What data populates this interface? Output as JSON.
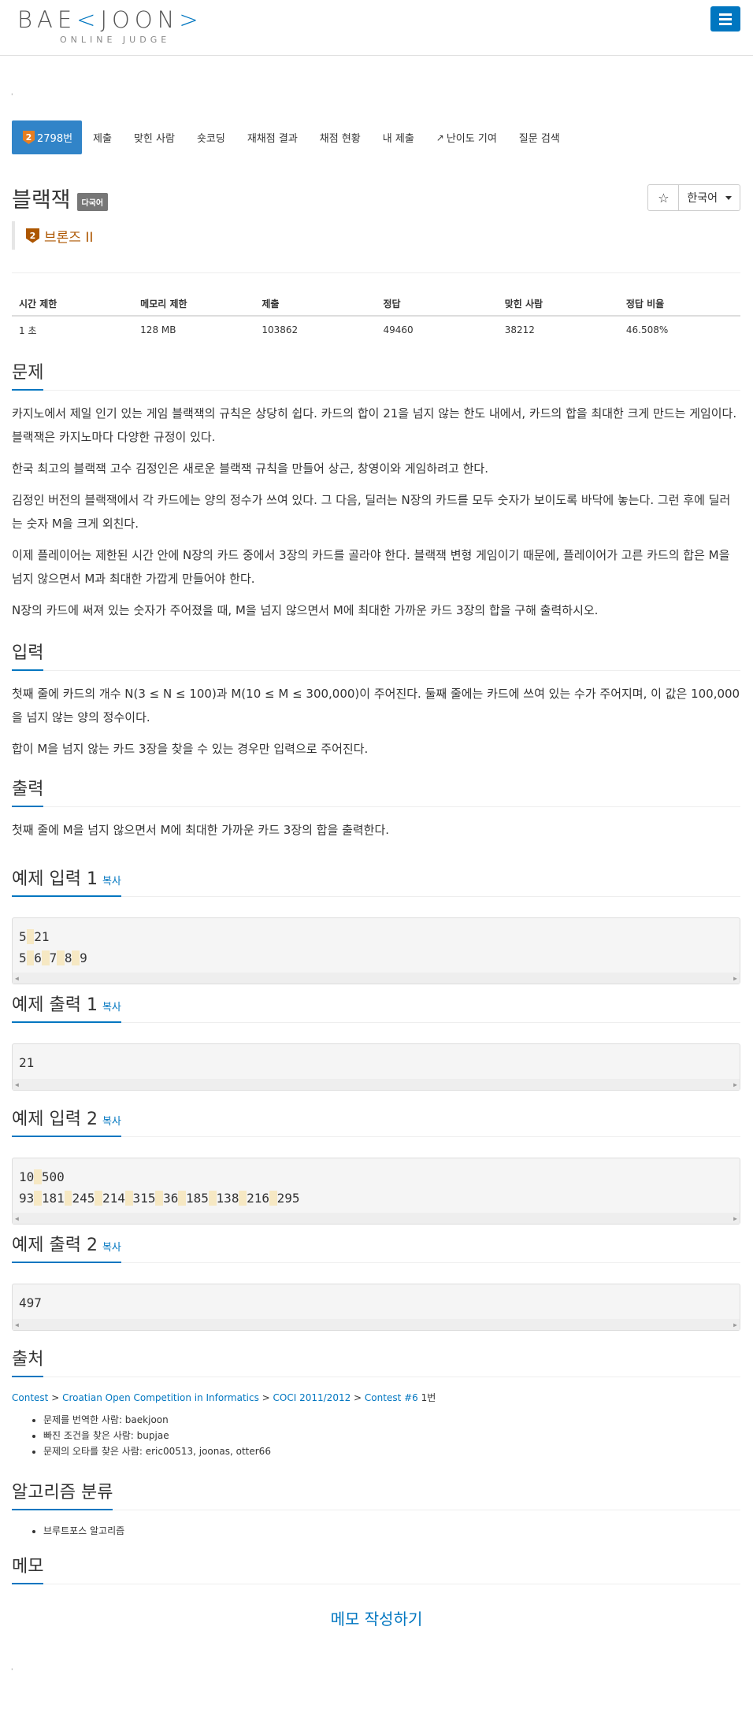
{
  "header": {
    "logo_left": "BAE",
    "logo_bracket_open": "<",
    "logo_right": "JOON",
    "logo_bracket_close": ">",
    "logo_sub": "ONLINE JUDGE"
  },
  "tiny_mark": "'",
  "tabs": [
    {
      "label": "2798번",
      "badge": "2"
    },
    {
      "label": "제출"
    },
    {
      "label": "맞힌 사람"
    },
    {
      "label": "숏코딩"
    },
    {
      "label": "재채점 결과"
    },
    {
      "label": "채점 현황"
    },
    {
      "label": "내 제출"
    },
    {
      "label": "난이도 기여"
    },
    {
      "label": "질문 검색"
    }
  ],
  "problem": {
    "title": "블랙잭",
    "multi_label": "다국어",
    "tier_badge": "2",
    "tier": "브론즈 II",
    "star": "☆",
    "language": "한국어"
  },
  "stats": {
    "headers": [
      "시간 제한",
      "메모리 제한",
      "제출",
      "정답",
      "맞힌 사람",
      "정답 비율"
    ],
    "values": [
      "1 초",
      "128 MB",
      "103862",
      "49460",
      "38212",
      "46.508%"
    ]
  },
  "sections": {
    "problem_title": "문제",
    "problem_paras": [
      "카지노에서 제일 인기 있는 게임 블랙잭의 규칙은 상당히 쉽다. 카드의 합이 21을 넘지 않는 한도 내에서, 카드의 합을 최대한 크게 만드는 게임이다. 블랙잭은 카지노마다 다양한 규정이 있다.",
      "한국 최고의 블랙잭 고수 김정인은 새로운 블랙잭 규칙을 만들어 상근, 창영이와 게임하려고 한다.",
      "김정인 버전의 블랙잭에서 각 카드에는 양의 정수가 쓰여 있다. 그 다음, 딜러는 N장의 카드를 모두 숫자가 보이도록 바닥에 놓는다. 그런 후에 딜러는 숫자 M을 크게 외친다.",
      "이제 플레이어는 제한된 시간 안에 N장의 카드 중에서 3장의 카드를 골라야 한다. 블랙잭 변형 게임이기 때문에, 플레이어가 고른 카드의 합은 M을 넘지 않으면서 M과 최대한 가깝게 만들어야 한다.",
      "N장의 카드에 써져 있는 숫자가 주어졌을 때, M을 넘지 않으면서 M에 최대한 가까운 카드 3장의 합을 구해 출력하시오."
    ],
    "input_title": "입력",
    "input_paras": [
      "첫째 줄에 카드의 개수 N(3 ≤ N ≤ 100)과 M(10 ≤ M ≤ 300,000)이 주어진다. 둘째 줄에는 카드에 쓰여 있는 수가 주어지며, 이 값은 100,000을 넘지 않는 양의 정수이다.",
      "합이 M을 넘지 않는 카드 3장을 찾을 수 있는 경우만 입력으로 주어진다."
    ],
    "output_title": "출력",
    "output_para": "첫째 줄에 M을 넘지 않으면서 M에 최대한 가까운 카드 3장의 합을 출력한다.",
    "copy_label": "복사",
    "sample_in1_title": "예제 입력 1",
    "sample_out1_title": "예제 출력 1",
    "sample_in2_title": "예제 입력 2",
    "sample_out2_title": "예제 출력 2",
    "source_title": "출처",
    "algo_title": "알고리즘 분류",
    "memo_title": "메모"
  },
  "samples": {
    "in1": [
      [
        "5",
        "21"
      ],
      [
        "5",
        "6",
        "7",
        "8",
        "9"
      ]
    ],
    "out1": [
      [
        "21"
      ]
    ],
    "in2": [
      [
        "10",
        "500"
      ],
      [
        "93",
        "181",
        "245",
        "214",
        "315",
        "36",
        "185",
        "138",
        "216",
        "295"
      ]
    ],
    "out2": [
      [
        "497"
      ]
    ]
  },
  "source": {
    "crumbs": [
      "Contest",
      "Croatian Open Competition in Informatics",
      "COCI 2011/2012",
      "Contest #6"
    ],
    "sep": " > ",
    "suffix": " 1번",
    "credits": [
      "문제를 번역한 사람: baekjoon",
      "빠진 조건을 찾은 사람: bupjae",
      "문제의 오타를 찾은 사람: eric00513, joonas, otter66"
    ]
  },
  "algorithms": [
    "브루트포스 알고리즘"
  ],
  "memo_link": "메모 작성하기"
}
